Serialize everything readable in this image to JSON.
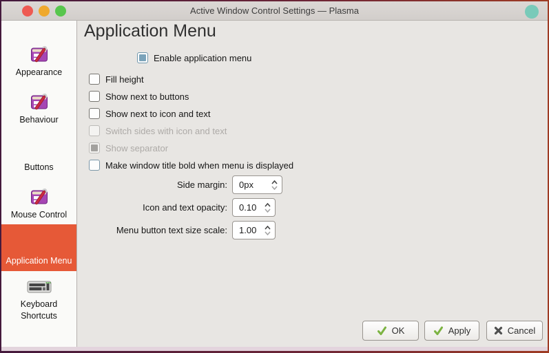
{
  "titlebar": {
    "title": "Active Window Control Settings — Plasma"
  },
  "sidebar": {
    "items": [
      {
        "label": "Appearance",
        "icon": "window-tool",
        "selected": false
      },
      {
        "label": "Behaviour",
        "icon": "window-tool",
        "selected": false
      },
      {
        "label": "Buttons",
        "icon": "none",
        "selected": false
      },
      {
        "label": "Mouse Control",
        "icon": "window-tool",
        "selected": false
      },
      {
        "label": "Application Menu",
        "icon": "none",
        "selected": true
      },
      {
        "label": "Keyboard Shortcuts",
        "icon": "keyboard",
        "selected": false
      }
    ]
  },
  "main": {
    "heading": "Application Menu",
    "checkboxes": [
      {
        "label": "Enable application menu",
        "checked": true,
        "enabled": true
      },
      {
        "label": "Fill height",
        "checked": false,
        "enabled": true
      },
      {
        "label": "Show next to buttons",
        "checked": false,
        "enabled": true
      },
      {
        "label": "Show next to icon and text",
        "checked": false,
        "enabled": true
      },
      {
        "label": "Switch sides with icon and text",
        "checked": false,
        "enabled": false
      },
      {
        "label": "Show separator",
        "checked": true,
        "enabled": false
      },
      {
        "label": "Make window title bold when menu is displayed",
        "checked": false,
        "enabled": true
      }
    ],
    "spinboxes": [
      {
        "label": "Side margin:",
        "value": "0px"
      },
      {
        "label": "Icon and text opacity:",
        "value": "0.10"
      },
      {
        "label": "Menu button text size scale:",
        "value": "1.00"
      }
    ]
  },
  "footer": {
    "buttons": [
      {
        "label": "OK",
        "icon": "check"
      },
      {
        "label": "Apply",
        "icon": "check"
      },
      {
        "label": "Cancel",
        "icon": "cross"
      }
    ]
  },
  "colors": {
    "selection_orange": "#e65937",
    "titlebar_bg": "#d7d3d0",
    "main_bg": "#e8e6e3",
    "sidebar_bg": "#fafaf8",
    "traffic_red": "#ee5a52",
    "traffic_yellow": "#efa92e",
    "traffic_green": "#58c64d",
    "user_dot_teal": "#79cab9",
    "checkbox_checked_blue": "#7ba3ba",
    "frame_gradient_left": "#44193c",
    "frame_gradient_right": "#9e3b24"
  }
}
